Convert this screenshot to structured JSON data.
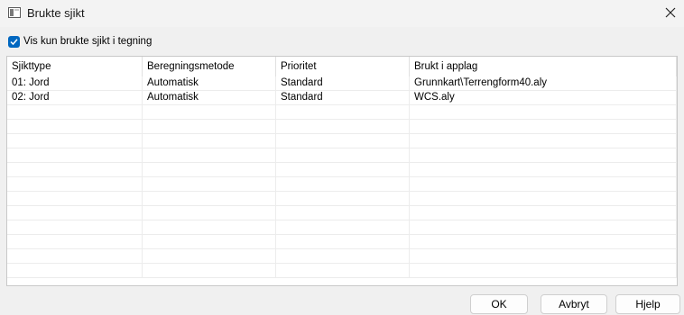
{
  "window": {
    "title": "Brukte sjikt",
    "close_icon": "close-icon"
  },
  "filter": {
    "label": "Vis kun brukte sjikt i tegning",
    "checked": true
  },
  "table": {
    "headers": [
      "Sjikttype",
      "Beregningsmetode",
      "Prioritet",
      "Brukt i applag"
    ],
    "rows": [
      [
        "01: Jord",
        "Automatisk",
        "Standard",
        "Grunnkart\\Terrengform40.aly"
      ],
      [
        "02: Jord",
        "Automatisk",
        "Standard",
        "WCS.aly"
      ]
    ]
  },
  "buttons": {
    "ok": "OK",
    "cancel": "Avbryt",
    "help": "Hjelp"
  },
  "colors": {
    "accent": "#0067c0"
  }
}
